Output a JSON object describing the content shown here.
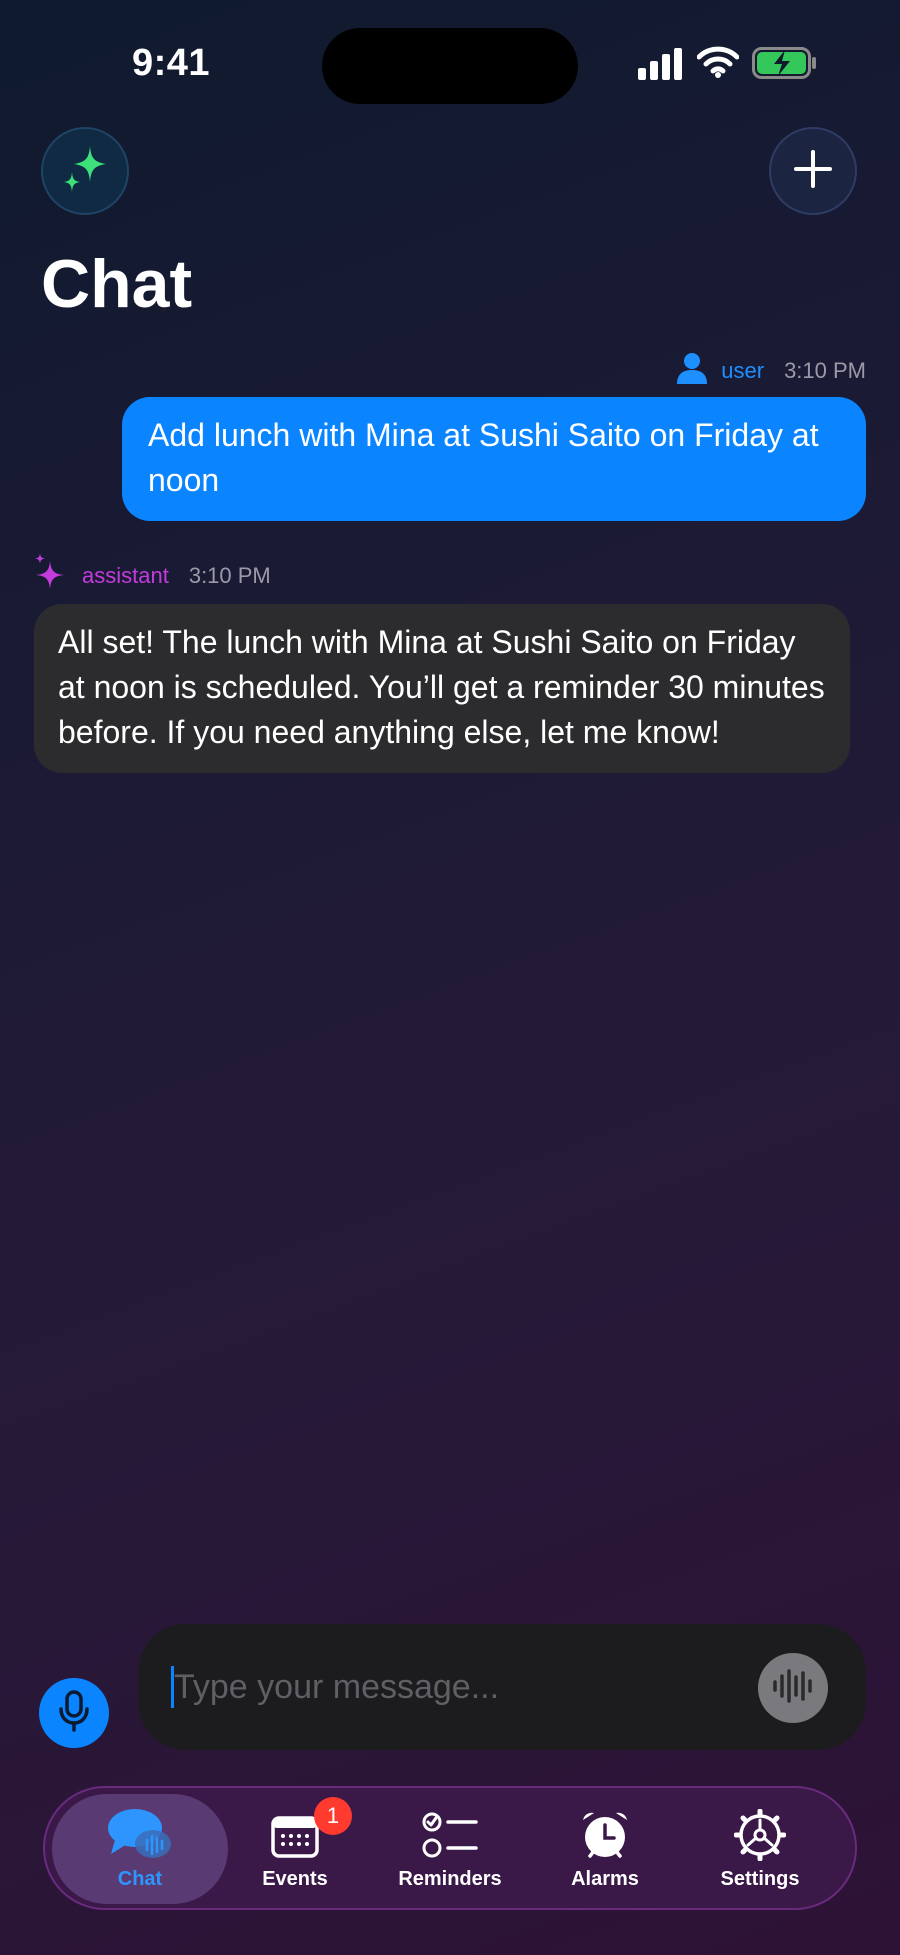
{
  "status_bar": {
    "time": "9:41"
  },
  "header": {
    "title": "Chat"
  },
  "messages": [
    {
      "role": "user",
      "sender": "user",
      "time": "3:10 PM",
      "text": "Add lunch with Mina at Sushi Saito on Friday at noon"
    },
    {
      "role": "assistant",
      "sender": "assistant",
      "time": "3:10 PM",
      "text": "All set! The lunch with Mina at Sushi Saito on Friday at noon is scheduled. You’ll get a reminder 30 minutes before. If you need anything else, let me know!"
    }
  ],
  "composer": {
    "placeholder": "Type your message...",
    "value": ""
  },
  "tabs": [
    {
      "label": "Chat",
      "icon": "chat-bubbles-icon",
      "active": true
    },
    {
      "label": "Events",
      "icon": "calendar-icon",
      "badge": "1"
    },
    {
      "label": "Reminders",
      "icon": "checklist-icon"
    },
    {
      "label": "Alarms",
      "icon": "alarm-clock-icon"
    },
    {
      "label": "Settings",
      "icon": "gear-icon"
    }
  ],
  "colors": {
    "accent": "#0a84ff",
    "assistant": "#c43bdc",
    "sparkle": "#3ee07a",
    "badge": "#ff3b30"
  }
}
